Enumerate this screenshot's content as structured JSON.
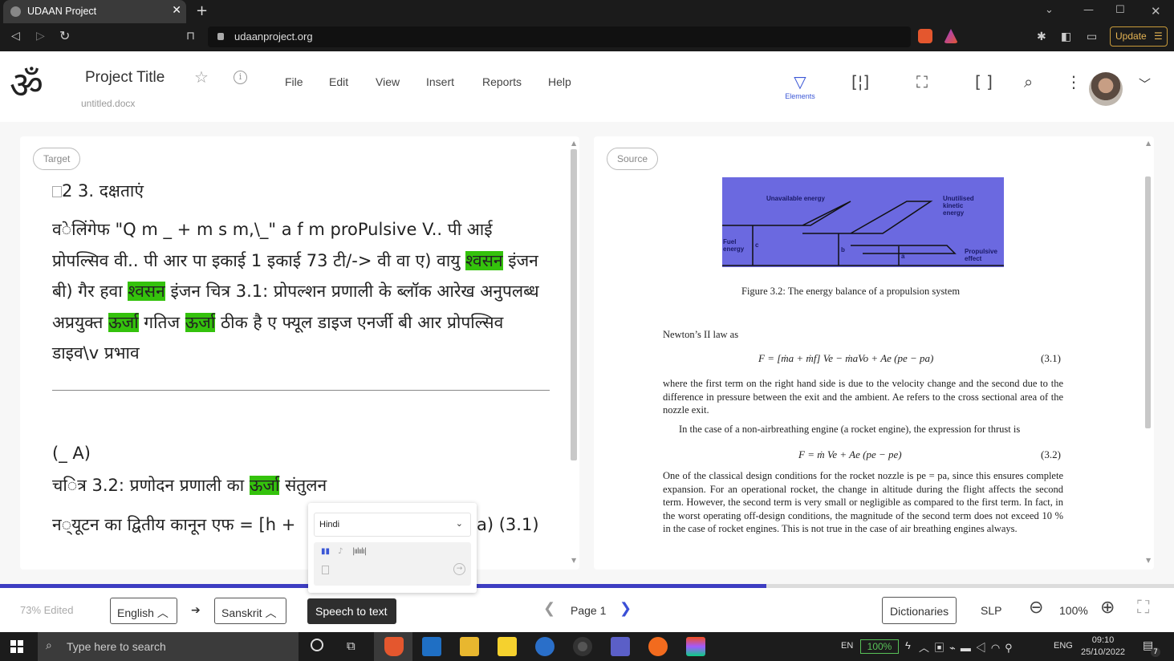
{
  "browser": {
    "tab_title": "UDAAN Project",
    "url": "udaanproject.org",
    "update_label": "Update",
    "brave_badge": "1",
    "alert_badge": "2"
  },
  "header": {
    "logo_glyph": "ॐ",
    "project_title": "Project Title",
    "file_name": "untitled.docx",
    "menu": [
      "File",
      "Edit",
      "View",
      "Insert",
      "Reports",
      "Help"
    ],
    "elements_label": "Elements"
  },
  "target": {
    "label": "Target",
    "heading": "2 3. दक्षताएं",
    "paragraph": [
      {
        "t": "व◌ेलिंगेफ \"Q m _ + m s m,\\_\" a f m proPulsive V.. पी आई प्रोपल्सिव वी.. पी आर पा इकाई 1 इकाई 73 टी/-> वी वा ए) वायु ",
        "h": false
      },
      {
        "t": "श्वसन",
        "h": true
      },
      {
        "t": " इंजन बी) गैर हवा ",
        "h": false
      },
      {
        "t": "श्वसन",
        "h": true
      },
      {
        "t": " इंजन चित्र 3.1: प्रोपल्शन प्रणाली के ब्लॉक आरेख अनुपलब्ध अप्रयुक्त ",
        "h": false
      },
      {
        "t": "ऊर्जा",
        "h": true
      },
      {
        "t": " गतिज ",
        "h": false
      },
      {
        "t": "ऊर्जा",
        "h": true
      },
      {
        "t": " ठीक है ए फ्यूल डाइज एनर्जी बी आर प्रोपल्सिव डाइव\\v प्रभाव",
        "h": false
      }
    ],
    "line_a": "(_ A)",
    "caption_pre": "च◌ित्र 3.2: प्रणोदन प्रणाली का ",
    "caption_hl": "ऊर्जा",
    "caption_post": " संतुलन",
    "newton_pre": "न◌्यूटन का द्वितीय कानून एफ = [h +",
    "newton_post": "a) (3.1)"
  },
  "source": {
    "label": "Source",
    "fig_labels": {
      "unavailable": "Unavailable energy",
      "unutilised": "Unutilised kinetic energy",
      "fuel": "Fuel energy",
      "propulsive": "Propulsive effect",
      "a": "a",
      "b": "b",
      "c": "c"
    },
    "fig_caption": "Figure 3.2: The energy balance of a propulsion system",
    "newton_line": "Newton’s II law as",
    "eq1": "F = [ṁa + ṁf] Ve − ṁaVo + Ae (pe − pa)",
    "eq1_no": "(3.1)",
    "p1": "where the first term on the right hand side is due to the velocity change and the second due to the difference in pressure between the exit and the ambient. Ae refers to the cross sectional area of the nozzle exit.",
    "p2": "In the case of a non-airbreathing engine (a rocket engine), the expression for thrust is",
    "eq2": "F = ṁ Ve + Ae (pe − pe)",
    "eq2_no": "(3.2)",
    "p3": "One of the classical design conditions for the rocket nozzle is pe = pa, since this ensures complete expansion. For an operational rocket, the change in altitude during the flight affects the second term. However, the second term is very small or negligible as compared to the first term. In fact, in the worst operating off-design conditions, the magnitude of the second term does not exceed 10 % in the case of rocket engines. This is not true in the case of air breathing engines always."
  },
  "popup": {
    "language": "Hindi"
  },
  "bottom": {
    "edited": "73% Edited",
    "source_lang": "English",
    "target_lang": "Sanskrit",
    "stt_label": "Speech to text",
    "page_label": "Page 1",
    "dictionaries": "Dictionaries",
    "slp": "SLP",
    "zoom": "100%",
    "progress_fraction": 0.653
  },
  "taskbar": {
    "search_placeholder": "Type here to search",
    "lang_en": "EN",
    "battery": "100%",
    "lang_eng": "ENG",
    "time": "09:10",
    "date": "25/10/2022",
    "notif_count": "7"
  },
  "colors": {
    "accent": "#3b57d6",
    "highlight": "#34c20c",
    "progress": "#3e3ec2",
    "figure_bg": "#6b69e0"
  }
}
